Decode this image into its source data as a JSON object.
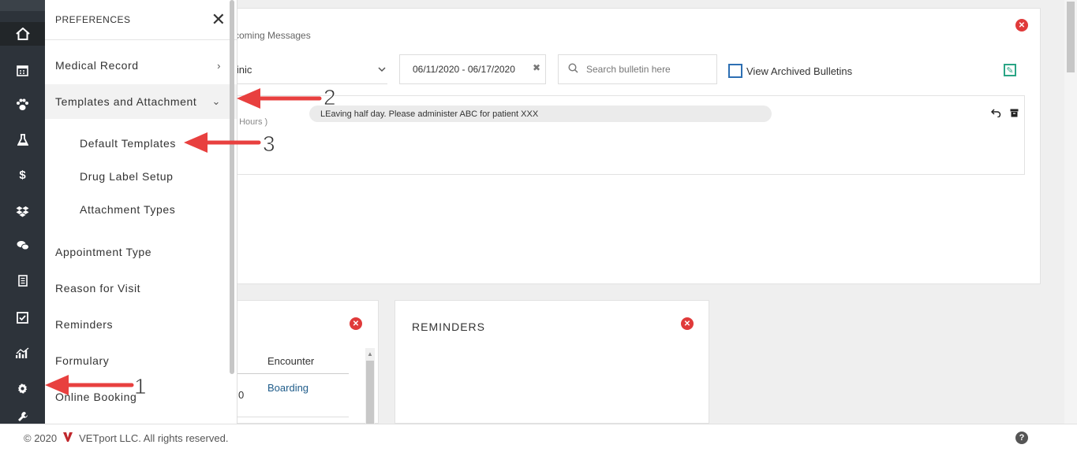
{
  "rail": {
    "icons": [
      "home-icon",
      "calendar-icon",
      "paw-icon",
      "flask-icon",
      "dollar-icon",
      "dropbox-icon",
      "chat-icon",
      "receipt-icon",
      "checkbox-icon",
      "chart-icon",
      "gear-icon",
      "wrench-icon"
    ]
  },
  "drawer": {
    "title": "PREFERENCES",
    "close": "✕",
    "items": [
      {
        "label": "Medical Record",
        "chevron": "›"
      },
      {
        "label": "Templates and Attachment",
        "chevron": "⌄"
      },
      {
        "label": "Default Templates"
      },
      {
        "label": "Drug Label Setup"
      },
      {
        "label": "Attachment Types"
      },
      {
        "label": "Appointment Type"
      },
      {
        "label": "Reason for Visit"
      },
      {
        "label": "Reminders"
      },
      {
        "label": "Formulary"
      },
      {
        "label": "Online Booking"
      }
    ]
  },
  "bulletin": {
    "upcoming": "coming Messages",
    "clinic": "linic",
    "date_range": "06/11/2020 - 06/17/2020",
    "search_placeholder": "Search bulletin here",
    "archived_label": "View Archived Bulletins",
    "hours": ". Hours )",
    "message": "LEaving half day. Please administer ABC for patient XXX"
  },
  "encounter_card": {
    "column": "Encounter",
    "value": "Boarding",
    "partial_value": "0"
  },
  "reminders_card": {
    "title": "REMINDERS"
  },
  "footer": {
    "copyright": "© 2020",
    "company": "VETport LLC. All rights reserved.",
    "help": "?"
  },
  "annotations": [
    "1",
    "2",
    "3"
  ],
  "colors": {
    "rail_bg": "#2d333a",
    "close_red": "#e03a3a",
    "arrow_red": "#e8403f",
    "link_blue": "#1f5c8a"
  }
}
